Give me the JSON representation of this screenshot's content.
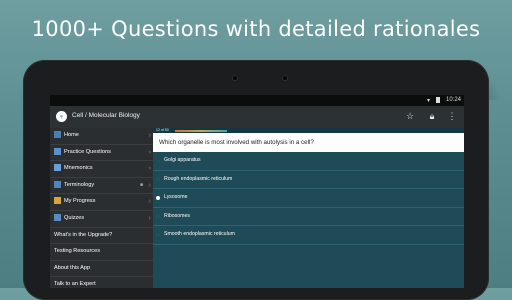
{
  "headline": "1000+ Questions with detailed rationales",
  "statusbar": {
    "time": "10:24"
  },
  "appbar": {
    "title": "Cell / Molecular Biology",
    "icons": [
      "star-icon",
      "lock-icon",
      "more-vert-icon"
    ]
  },
  "drawer": {
    "items": [
      {
        "label": "Home",
        "icon": "home-icon",
        "chevron": true
      },
      {
        "label": "Practice Questions",
        "icon": "questions-icon",
        "chevron": true
      },
      {
        "label": "Mnemonics",
        "icon": "mnemonics-icon",
        "chevron": true
      },
      {
        "label": "Terminology",
        "icon": "terminology-icon",
        "chevron": true,
        "locked": true
      },
      {
        "label": "My Progress",
        "icon": "progress-icon",
        "chevron": true
      },
      {
        "label": "Quizzes",
        "icon": "quizzes-icon",
        "chevron": true
      },
      {
        "label": "What's in the Upgrade?"
      },
      {
        "label": "Testing Resources"
      },
      {
        "label": "About this App"
      },
      {
        "label": "Talk to an Expert"
      }
    ]
  },
  "quiz": {
    "progress_label": "12 of 50",
    "question": "Which organelle is most involved with autolysis in a cell?",
    "answers": [
      {
        "text": "Golgi apparatus",
        "selected": false
      },
      {
        "text": "Rough endoplasmic reticulum",
        "selected": false
      },
      {
        "text": "Lysosome",
        "selected": true
      },
      {
        "text": "Ribosomes",
        "selected": false
      },
      {
        "text": "Smooth endoplasmic reticulum",
        "selected": false
      }
    ]
  },
  "colors": {
    "background": "#5d8f92",
    "screen": "#1e4b57",
    "drawer": "#2b2e30",
    "appbar": "#2c3133"
  }
}
